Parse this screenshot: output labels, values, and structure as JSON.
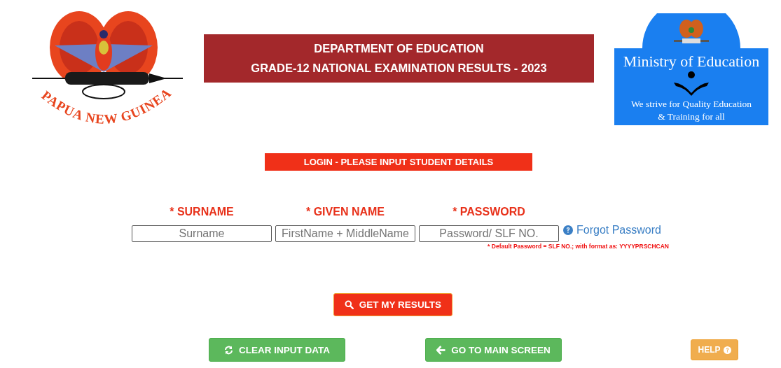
{
  "header": {
    "emblem_caption": "PAPUA NEW GUINEA",
    "title_lines": [
      "DEPARTMENT OF EDUCATION",
      "GRADE-12 NATIONAL EXAMINATION RESULTS - 2023"
    ],
    "ministry_logo": {
      "title": "Ministry of Education",
      "motto_lines": [
        "We strive for Quality Education",
        "& Training for all"
      ]
    }
  },
  "login_heading": "LOGIN - PLEASE INPUT STUDENT DETAILS",
  "fields": [
    {
      "label": "* SURNAME",
      "placeholder": "Surname"
    },
    {
      "label": "* GIVEN NAME",
      "placeholder": "FirstName + MiddleName"
    },
    {
      "label": "* PASSWORD",
      "placeholder": "Password/ SLF NO."
    }
  ],
  "forgot_password": "Forgot Password",
  "password_note": "* Default Password = SLF NO.; with format as: YYYYPRSCHCAN",
  "submit_button": "GET MY RESULTS",
  "buttons": [
    {
      "label": "CLEAR INPUT DATA",
      "kind": "clear"
    },
    {
      "label": "GO TO MAIN SCREEN",
      "kind": "back"
    },
    {
      "label": "HELP",
      "kind": "help"
    }
  ]
}
